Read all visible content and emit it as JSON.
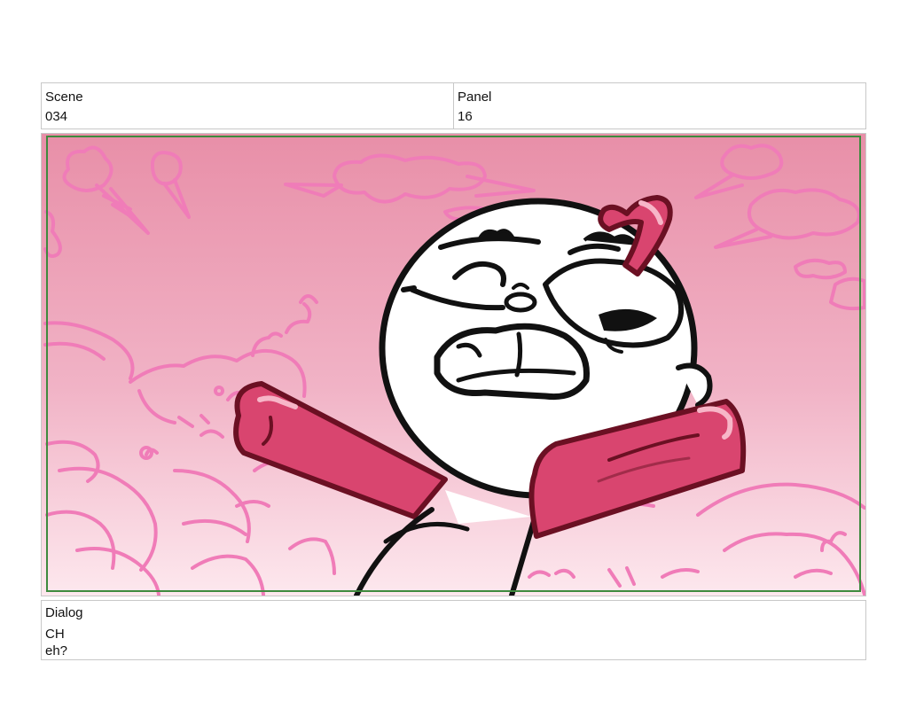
{
  "header": {
    "scene_label": "Scene",
    "scene_value": "034",
    "panel_label": "Panel",
    "panel_value": "16"
  },
  "dialog": {
    "label": "Dialog",
    "speaker": "CH",
    "line": "eh?"
  },
  "artwork": {
    "sky_top_color": "#e88fa8",
    "sky_bottom_color": "#fde8ee",
    "doodle_color": "#f07cb8",
    "jelly_color": "#d9456f",
    "jelly_outline_color": "#6b1023",
    "safe_frame_color": "#3e8a3e"
  }
}
